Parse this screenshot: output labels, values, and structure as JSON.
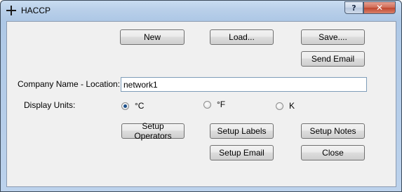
{
  "window": {
    "title": "HACCP",
    "help_label": "?",
    "close_label": "✕"
  },
  "buttons": {
    "new": "New",
    "load": "Load...",
    "save": "Save....",
    "send_email": "Send Email",
    "setup_operators": "Setup Operators",
    "setup_labels": "Setup Labels",
    "setup_notes": "Setup Notes",
    "setup_email": "Setup Email",
    "close": "Close"
  },
  "company": {
    "label": "Company Name - Location:",
    "value": "network1"
  },
  "units": {
    "label": "Display Units:",
    "options": [
      {
        "label": "°C",
        "selected": true
      },
      {
        "label": "°F",
        "selected": false
      },
      {
        "label": "K",
        "selected": false
      }
    ]
  }
}
